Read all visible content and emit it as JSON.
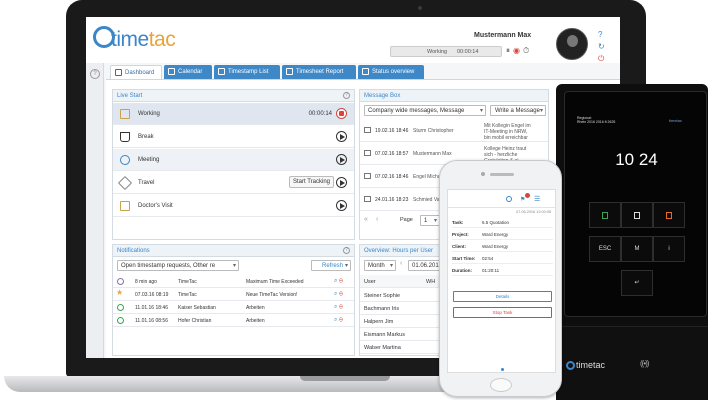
{
  "app": {
    "logo": {
      "time": "time",
      "tac": "tac"
    },
    "user_name": "Mustermann Max",
    "status": {
      "label": "Working",
      "time": "00:00:14"
    }
  },
  "tabs": [
    {
      "label": "Dashboard"
    },
    {
      "label": "Calendar"
    },
    {
      "label": "Timestamp List"
    },
    {
      "label": "Timesheet Report"
    },
    {
      "label": "Status overview"
    }
  ],
  "live_start": {
    "title": "Live Start",
    "items": [
      {
        "label": "Working",
        "time": "00:00:14"
      },
      {
        "label": "Break"
      },
      {
        "label": "Meeting"
      },
      {
        "label": "Travel",
        "action": "Start Tracking"
      },
      {
        "label": "Doctor's Visit"
      }
    ]
  },
  "message_box": {
    "title": "Message Box",
    "filter": "Company wide messages, Message",
    "write_button": "Write a Message",
    "rows": [
      {
        "date": "19.02.16 18:46",
        "from": "Sturm Christopher",
        "text": "Mit Kollegin Engel im IT-Meeting in NRW, bin mobil erreichbar"
      },
      {
        "date": "07.02.16 18:57",
        "from": "Mustermann Max",
        "text": "Kollege Heinz traut sich - herzliche Gratulation & ei"
      },
      {
        "date": "07.02.16 18:46",
        "from": "Engel Michael",
        "text": ""
      },
      {
        "date": "24.01.16 18:23",
        "from": "Schmied Vale",
        "text": ""
      }
    ],
    "page_label": "Page",
    "page": "1"
  },
  "notifications": {
    "title": "Notifications",
    "filter": "Open timestamp requests, Other re",
    "refresh": "Refresh",
    "rows": [
      {
        "date": "8 min ago",
        "from": "TimeTac",
        "text": "Maximum Time Exceeded"
      },
      {
        "date": "07.03.16 08:19",
        "from": "TimeTac",
        "text": "Neue TimeTac Version!"
      },
      {
        "date": "11.01.16 18:46",
        "from": "Kaiser Sebastian",
        "text": "Arbeiten"
      },
      {
        "date": "11.01.16 08:56",
        "from": "Hofer Christian",
        "text": "Arbeiten"
      }
    ]
  },
  "overview": {
    "title": "Overview: Hours per User",
    "period": "Month",
    "date": "01.06.2016",
    "col_user": "User",
    "col_wh": "WH",
    "users": [
      "Steiner Sophie",
      "Bachmann Iris",
      "Halpern Jim",
      "Eismann Markus",
      "Walser Martina"
    ]
  },
  "phone": {
    "date": "07.06.2016 12:00:05",
    "fields": [
      {
        "key": "Task:",
        "value": "6.5 Quotation"
      },
      {
        "key": "Project:",
        "value": "Ward Energy"
      },
      {
        "key": "Client:",
        "value": "Ward Energy"
      },
      {
        "key": "Start Time:",
        "value": "02:54"
      },
      {
        "key": "Duration:",
        "value": "01:20:11"
      }
    ],
    "details_button": "Details",
    "stop_button": "Stop Task"
  },
  "terminal": {
    "header": "Regional:\nRhein 2016 2016 ft 2625",
    "logo": "timetac",
    "time": "10 24",
    "keys": [
      "ESC",
      "M",
      "i"
    ],
    "brand": "timetac",
    "nfc": "((•))"
  },
  "colors": {
    "accent": "#3a86c8",
    "brand_orange": "#e8a33a",
    "stop": "#d9453c"
  }
}
